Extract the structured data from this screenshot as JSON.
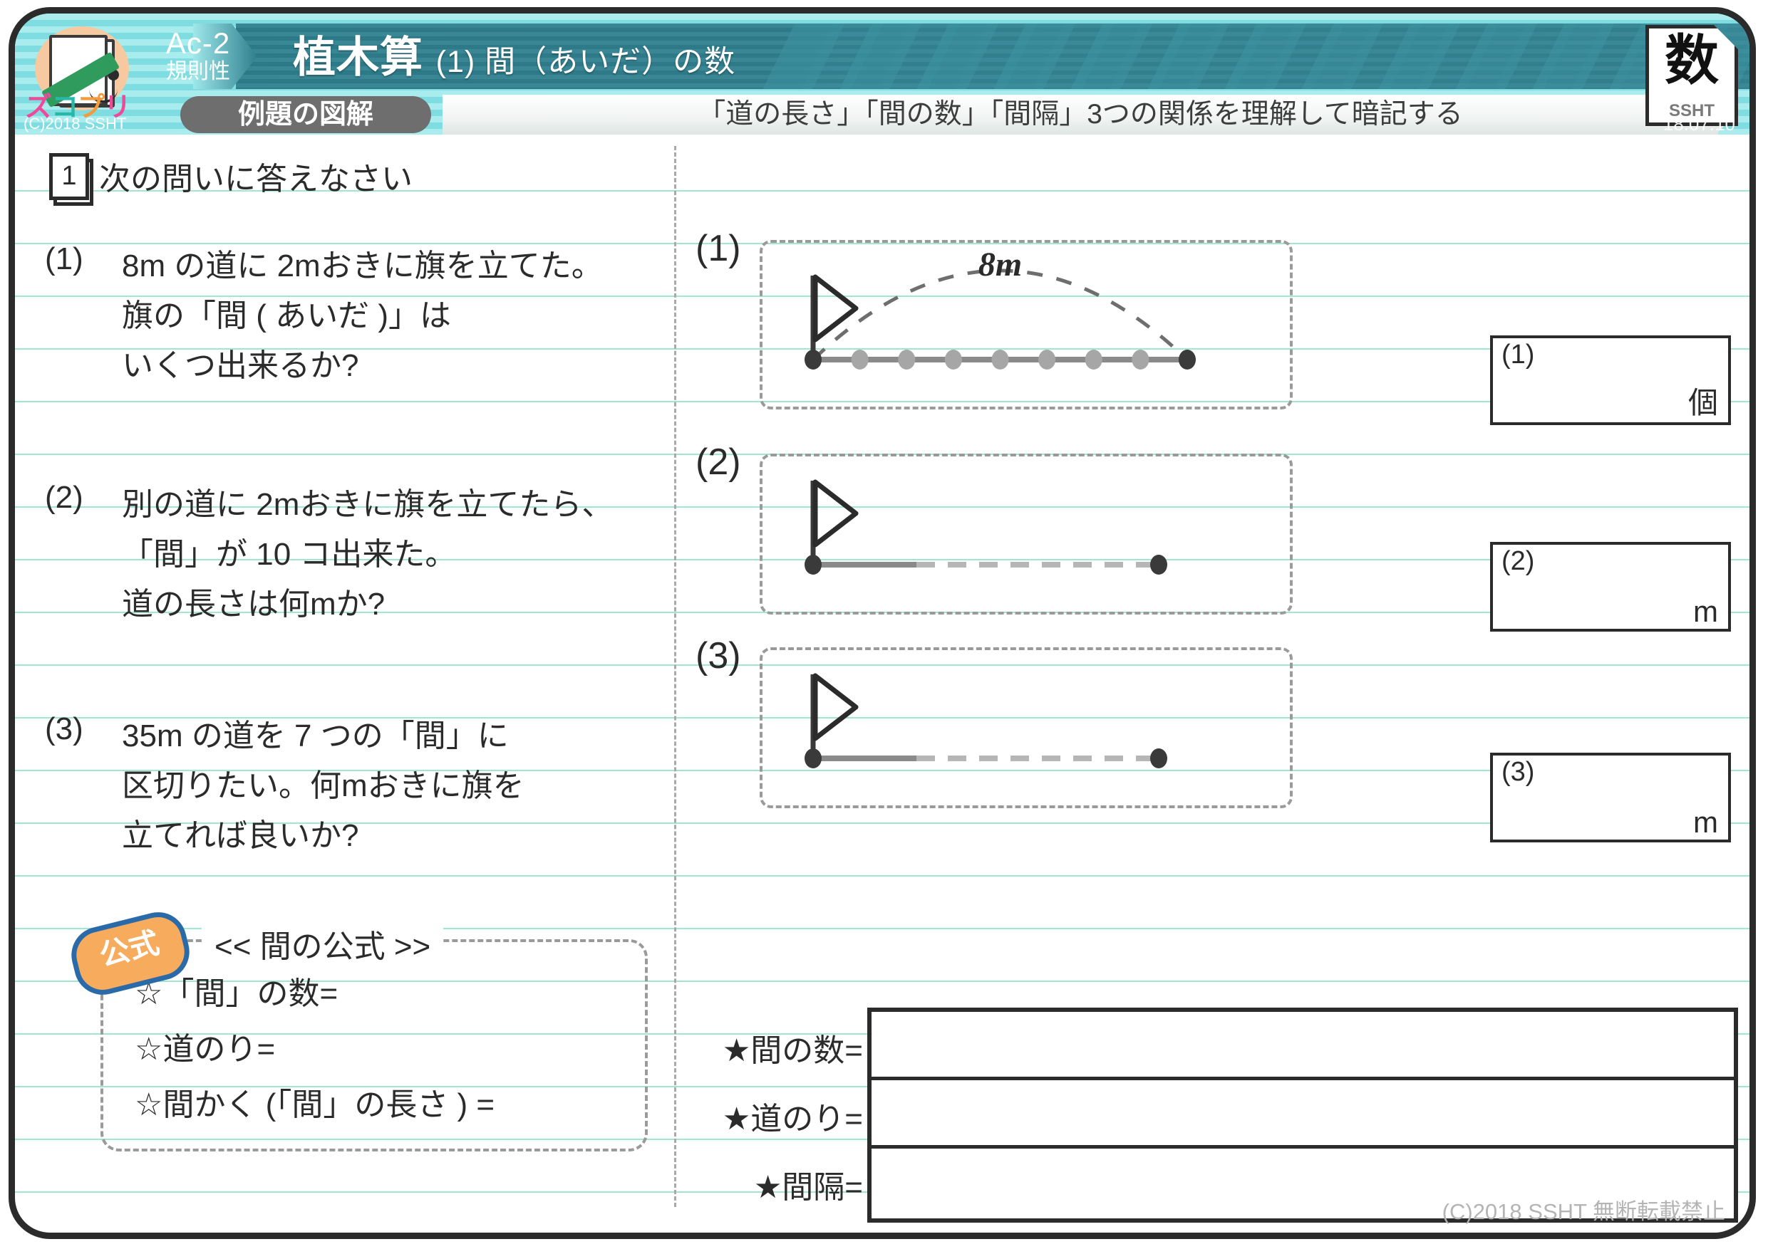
{
  "header": {
    "code_main": "Ac-2",
    "code_sub": "規則性",
    "title_main": "植木算",
    "title_sub": "(1) 間（あいだ）の数",
    "badge_label": "例題の図解",
    "subtitle": "「道の長さ」「間の数」「間隔」3つの関係を理解して暗記する",
    "doc_badge_kanji": "数",
    "doc_badge_sub": "SSHT",
    "date": "18.07.10",
    "logo_word": "ズコプリ",
    "logo_copyright": "(C)2018 SSHT"
  },
  "problem": {
    "number": "1",
    "lead": "次の問いに答えなさい",
    "items": [
      {
        "index": "(1)",
        "lines": [
          "8m の道に 2mおきに旗を立てた。",
          "旗の「間 ( あいだ )」は",
          "いくつ出来るか?"
        ]
      },
      {
        "index": "(2)",
        "lines": [
          "別の道に 2mおきに旗を立てたら、",
          "「間」が 10 コ出来た。",
          "道の長さは何mか?"
        ]
      },
      {
        "index": "(3)",
        "lines": [
          "35m の道を 7 つの「間」に",
          "区切りたい。何mおきに旗を",
          "立てれば良いか?"
        ]
      }
    ]
  },
  "formula": {
    "badge": "公式",
    "title": "<< 間の公式 >>",
    "lines": [
      "☆「間」の数=",
      "☆道のり=",
      "☆間かく (「間」の長さ ) ="
    ]
  },
  "diagrams": [
    {
      "label": "(1)",
      "arc_label": "8m",
      "dots_total": 9,
      "dots_interior": 7,
      "road_style": "solid"
    },
    {
      "label": "(2)",
      "arc_label": "",
      "dots_total": 2,
      "dots_interior": 0,
      "road_style": "fading"
    },
    {
      "label": "(3)",
      "arc_label": "",
      "dots_total": 2,
      "dots_interior": 0,
      "road_style": "fading"
    }
  ],
  "answers": [
    {
      "index": "(1)",
      "unit": "個",
      "value": ""
    },
    {
      "index": "(2)",
      "unit": "m",
      "value": ""
    },
    {
      "index": "(3)",
      "unit": "m",
      "value": ""
    }
  ],
  "summary": {
    "rows": [
      {
        "label": "★間の数=",
        "value": ""
      },
      {
        "label": "★道のり=",
        "value": ""
      },
      {
        "label": "★間隔=",
        "value": ""
      }
    ]
  },
  "footer": "(C)2018 SSHT 無断転載禁止",
  "colors": {
    "header_light": "#9fe8ea",
    "header_bar": "#2e7f8e",
    "rule_line": "#8fe3c4",
    "badge_gray": "#6e6e6e",
    "formula_badge": "#f7ab5d",
    "formula_badge_border": "#2a6aa8"
  }
}
